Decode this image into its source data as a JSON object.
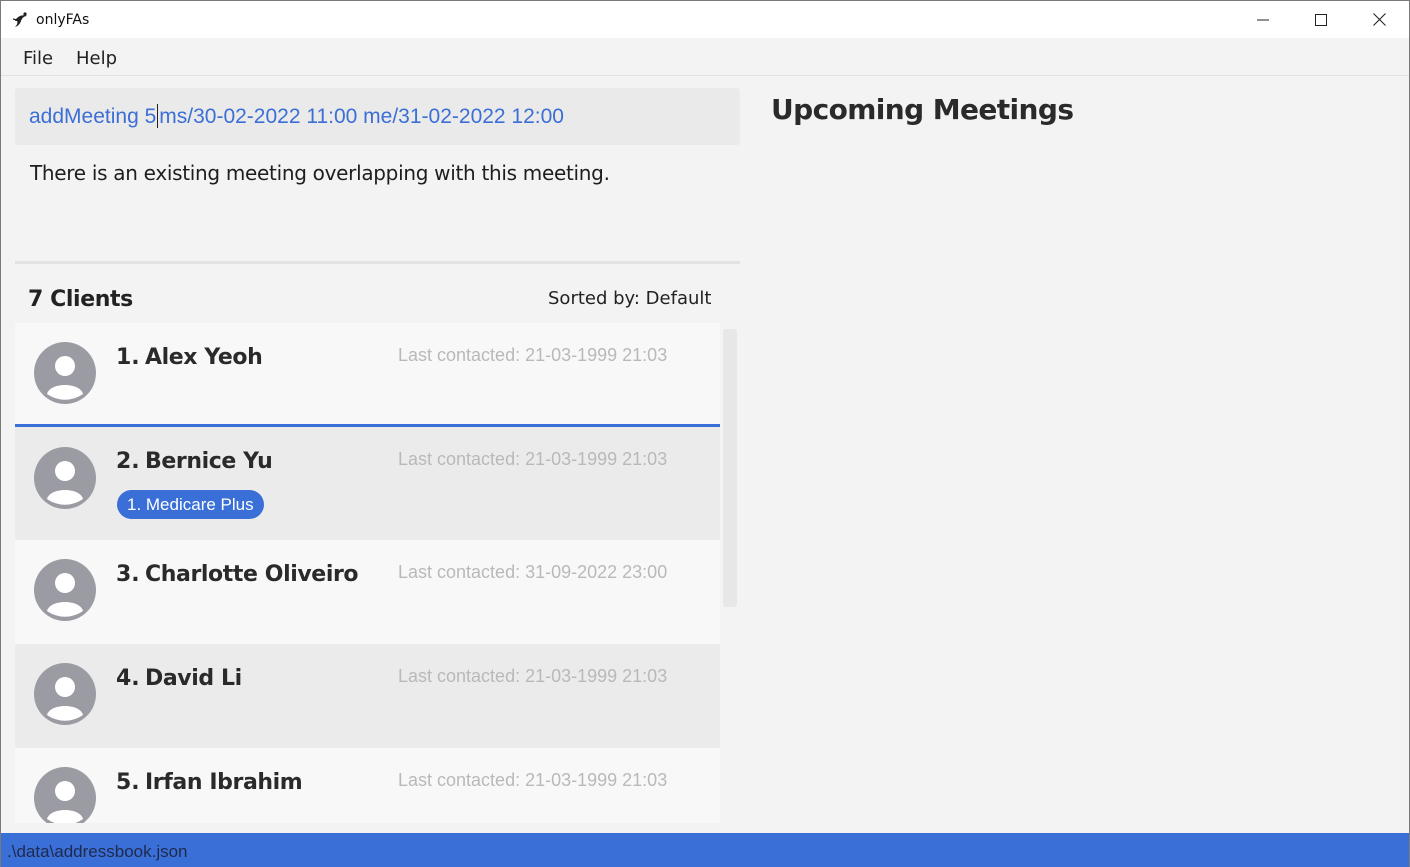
{
  "window": {
    "title": "onlyFAs",
    "controls": {
      "minimize_icon": "minimize-icon",
      "maximize_icon": "maximize-icon",
      "close_icon": "close-icon"
    }
  },
  "menu": {
    "items": [
      {
        "label": "File"
      },
      {
        "label": "Help"
      }
    ]
  },
  "command": {
    "text_before_caret": "addMeeting 5",
    "text_after_caret": "ms/30-02-2022 11:00 me/31-02-2022 12:00"
  },
  "result": {
    "message": "There is an existing meeting overlapping with this meeting."
  },
  "clients": {
    "title": "7 Clients",
    "sorted_by": "Sorted by: Default",
    "items": [
      {
        "index": "1.",
        "name": "Alex Yeoh",
        "last_contacted": "Last contacted: 21-03-1999 21:03",
        "tags": []
      },
      {
        "index": "2.",
        "name": "Bernice Yu",
        "last_contacted": "Last contacted: 21-03-1999 21:03",
        "tags": [
          "1. Medicare Plus"
        ]
      },
      {
        "index": "3.",
        "name": "Charlotte Oliveiro",
        "last_contacted": "Last contacted: 31-09-2022 23:00",
        "tags": []
      },
      {
        "index": "4.",
        "name": "David Li",
        "last_contacted": "Last contacted: 21-03-1999 21:03",
        "tags": []
      },
      {
        "index": "5.",
        "name": "Irfan Ibrahim",
        "last_contacted": "Last contacted: 21-03-1999 21:03",
        "tags": []
      }
    ]
  },
  "meetings": {
    "title": "Upcoming Meetings"
  },
  "status": {
    "file_path": ".\\data\\addressbook.json"
  },
  "colors": {
    "accent": "#3a6fd8",
    "command_text": "#3c6fd6",
    "muted_text": "#b9b9b9"
  }
}
